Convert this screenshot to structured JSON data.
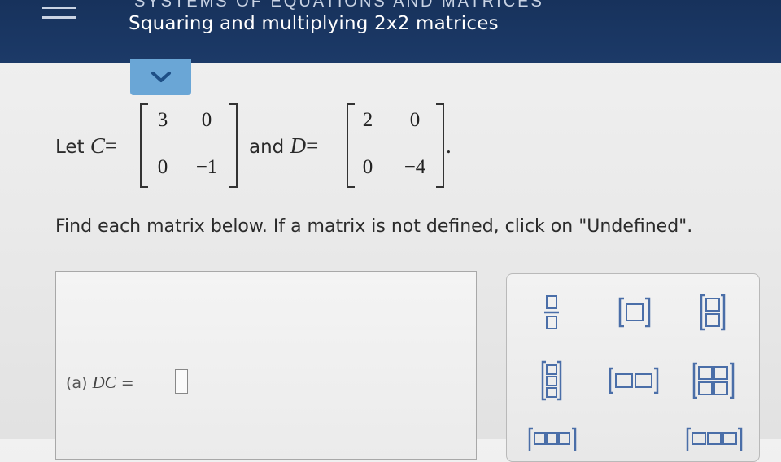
{
  "header": {
    "section_title": "SYSTEMS OF EQUATIONS AND MATRICES",
    "page_title": "Squaring and multiplying 2x2 matrices"
  },
  "problem": {
    "let_text": "Let",
    "c_name": "C",
    "and_text": "and",
    "d_name": "D",
    "equals": "=",
    "period": ".",
    "matrix_c": [
      "3",
      "0",
      "0",
      "−1"
    ],
    "matrix_d": [
      "2",
      "0",
      "0",
      "−4"
    ],
    "instruction": "Find each matrix below. If a matrix is not defined, click on \"Undefined\"."
  },
  "answer": {
    "label_prefix": "(a)",
    "expression": "DC",
    "equals": "="
  },
  "palette": {
    "buttons": [
      "fraction-icon",
      "matrix-1x1-icon",
      "matrix-2x1-icon",
      "matrix-3x1-icon",
      "matrix-1x2-icon",
      "matrix-2x2-icon",
      "matrix-1x3-icon",
      "matrix-2x3-icon"
    ]
  },
  "colors": {
    "header_bg": "#1b3866",
    "tab_bg": "#6aa6d6",
    "accent": "#2d5ea8"
  }
}
